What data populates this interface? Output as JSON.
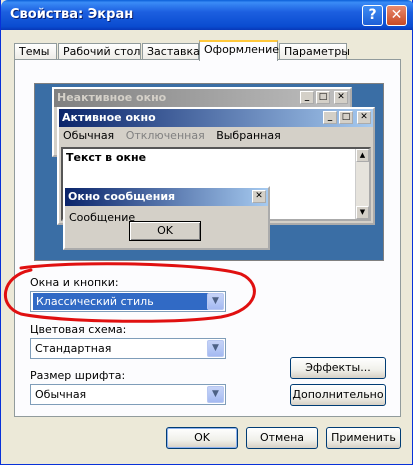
{
  "window": {
    "title": "Свойства: Экран",
    "help_glyph": "?",
    "close_glyph": "✕"
  },
  "tabs": [
    {
      "label": "Темы"
    },
    {
      "label": "Рабочий стол"
    },
    {
      "label": "Заставка"
    },
    {
      "label": "Оформление",
      "active": true
    },
    {
      "label": "Параметры"
    }
  ],
  "preview": {
    "inactive_title": "Неактивное окно",
    "active_title": "Активное окно",
    "menu_normal": "Обычная",
    "menu_disabled": "Отключенная",
    "menu_selected": "Выбранная",
    "window_text": "Текст в окне",
    "message_title": "Окно сообщения",
    "message_text": "Сообщение",
    "message_ok": "OK"
  },
  "form": {
    "windows_label": "Окна и кнопки:",
    "windows_value": "Классический стиль",
    "scheme_label": "Цветовая схема:",
    "scheme_value": "Стандартная",
    "font_label": "Размер шрифта:",
    "font_value": "Обычная"
  },
  "buttons": {
    "effects": "Эффекты...",
    "advanced": "Дополнительно",
    "ok": "OK",
    "cancel": "Отмена",
    "apply": "Применить"
  },
  "colors": {
    "titlebar": "#0a4cd0",
    "annotation": "#e01010",
    "selection": "#316ac5",
    "desktop": "#3a6ea5"
  }
}
